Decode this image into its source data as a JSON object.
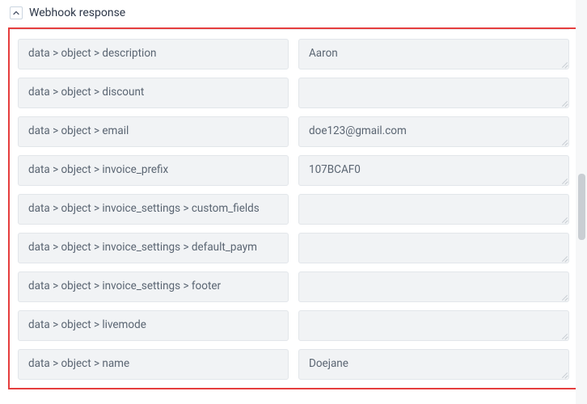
{
  "header": {
    "title": "Webhook response"
  },
  "rows": [
    {
      "path": "data > object > description",
      "value": "Aaron"
    },
    {
      "path": "data > object > discount",
      "value": ""
    },
    {
      "path": "data > object > email",
      "value": "doe123@gmail.com"
    },
    {
      "path": "data > object > invoice_prefix",
      "value": "107BCAF0"
    },
    {
      "path": "data > object > invoice_settings > custom_fields",
      "value": ""
    },
    {
      "path": "data > object > invoice_settings > default_paym",
      "value": ""
    },
    {
      "path": "data > object > invoice_settings > footer",
      "value": ""
    },
    {
      "path": "data > object > livemode",
      "value": ""
    },
    {
      "path": "data > object > name",
      "value": "Doejane"
    }
  ]
}
